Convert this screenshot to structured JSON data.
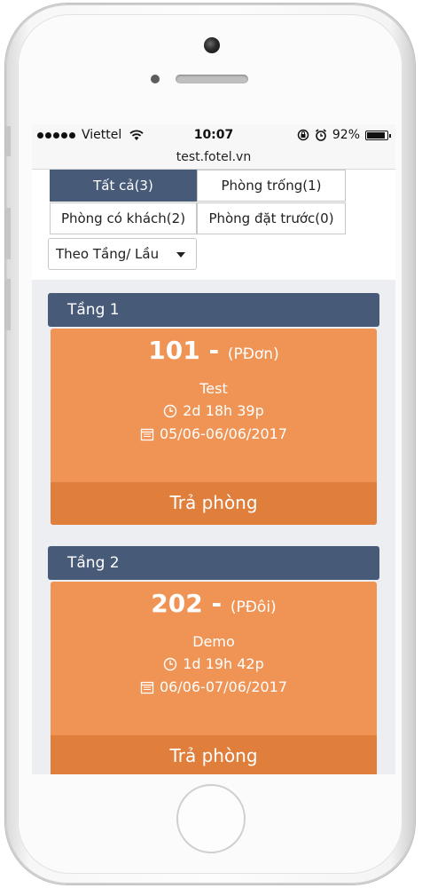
{
  "status_bar": {
    "carrier": "Viettel",
    "time": "10:07",
    "battery": "92%",
    "battery_level": 0.92
  },
  "browser": {
    "url": "test.fotel.vn"
  },
  "filters": {
    "all": "Tất cả(3)",
    "empty": "Phòng trống(1)",
    "occupied": "Phòng có khách(2)",
    "reserved": "Phòng đặt trước(0)",
    "active": "all"
  },
  "floor_select": {
    "value": "Theo Tầng/ Lầu"
  },
  "floors": [
    {
      "name": "Tầng 1",
      "room": {
        "number": "101 - ",
        "type": "(PĐơn)",
        "guest": "Test",
        "duration": "2d 18h 39p",
        "dates": "05/06-06/06/2017",
        "action": "Trả phòng"
      }
    },
    {
      "name": "Tầng 2",
      "room": {
        "number": "202 - ",
        "type": "(PĐôi)",
        "guest": "Demo",
        "duration": "1d 19h 42p",
        "dates": "06/06-07/06/2017",
        "action": "Trả phòng"
      }
    }
  ],
  "colors": {
    "header_blue": "#475a78",
    "room_orange": "#ef9455",
    "button_orange": "#e07e3c"
  },
  "icons": {
    "duration": "clock-icon",
    "dates": "calendar-icon",
    "wifi": "wifi-icon",
    "alarm": "alarm-icon",
    "lock": "rotation-lock-icon"
  }
}
